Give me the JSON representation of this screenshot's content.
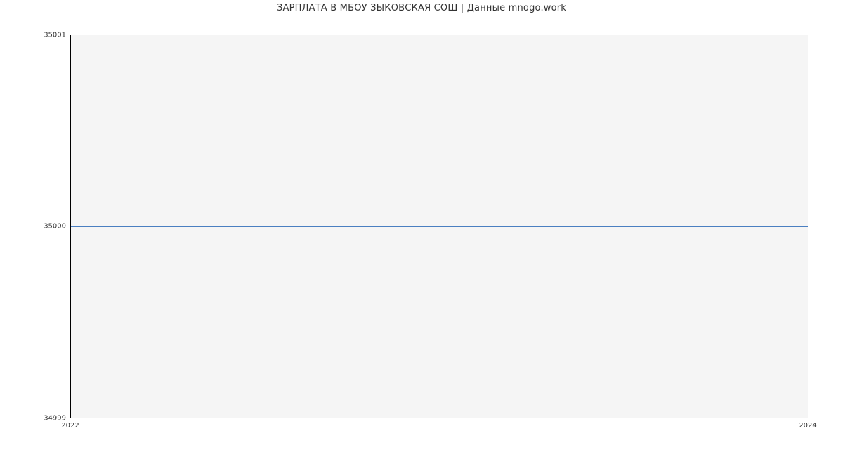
{
  "chart_data": {
    "type": "line",
    "title": "ЗАРПЛАТА В МБОУ ЗЫКОВСКАЯ СОШ | Данные mnogo.work",
    "xlabel": "",
    "ylabel": "",
    "x": [
      2022,
      2024
    ],
    "values": [
      35000,
      35000
    ],
    "xlim": [
      2022,
      2024
    ],
    "ylim": [
      34999,
      35001
    ],
    "x_ticks": [
      "2022",
      "2024"
    ],
    "y_ticks": [
      "34999",
      "35000",
      "35001"
    ],
    "line_color": "#4a7fc1",
    "background": "#f5f5f5"
  }
}
